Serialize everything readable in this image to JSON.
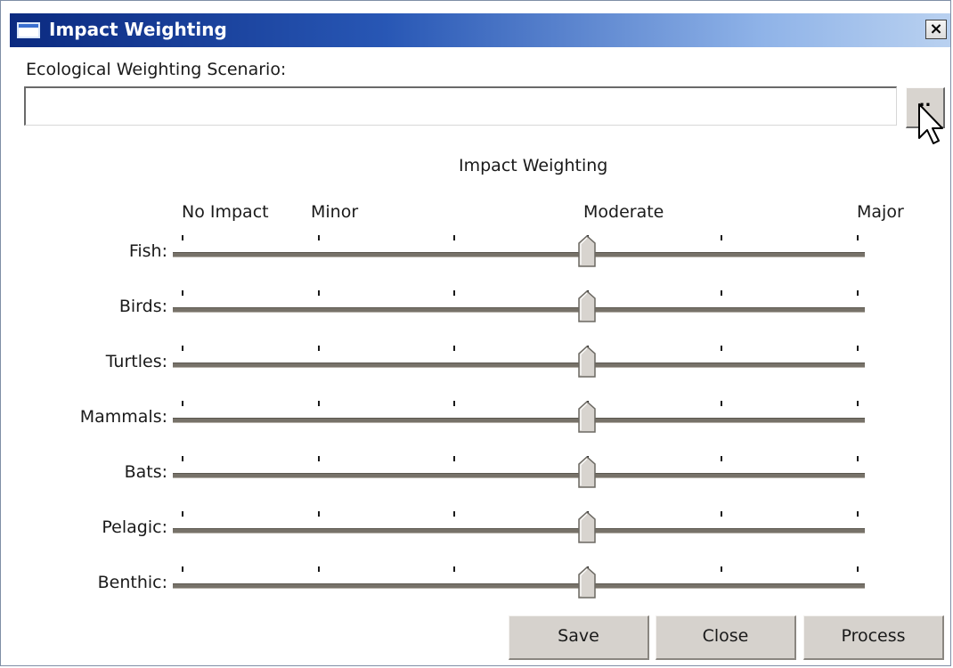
{
  "window": {
    "title": "Impact Weighting",
    "close_glyph": "×"
  },
  "scenario": {
    "label": "Ecological Weighting Scenario:",
    "value": "",
    "browse_label": "..",
    "browse_icon": "ellipsis-icon"
  },
  "weighting": {
    "group_title": "Impact Weighting",
    "scale_labels": {
      "no_impact": "No Impact",
      "minor": "Minor",
      "moderate": "Moderate",
      "major": "Major"
    },
    "tick_count": 6,
    "sliders": [
      {
        "label": "Fish:",
        "value": 3,
        "max": 5
      },
      {
        "label": "Birds:",
        "value": 3,
        "max": 5
      },
      {
        "label": "Turtles:",
        "value": 3,
        "max": 5
      },
      {
        "label": "Mammals:",
        "value": 3,
        "max": 5
      },
      {
        "label": "Bats:",
        "value": 3,
        "max": 5
      },
      {
        "label": "Pelagic:",
        "value": 3,
        "max": 5
      },
      {
        "label": "Benthic:",
        "value": 3,
        "max": 5
      }
    ]
  },
  "buttons": {
    "save": "Save",
    "close": "Close",
    "process": "Process"
  },
  "colors": {
    "titlebar_start": "#0b2a80",
    "titlebar_end": "#b9d1f0",
    "button_face": "#d6d2cd",
    "track": "#777269"
  }
}
